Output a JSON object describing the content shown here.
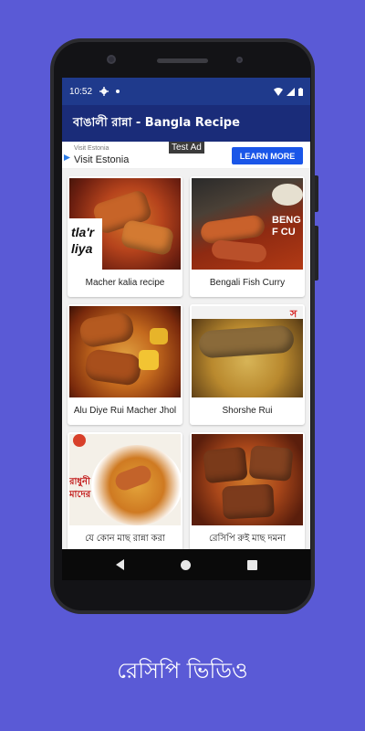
{
  "status_bar": {
    "time": "10:52"
  },
  "app_bar": {
    "title": "বাঙালী রান্না - Bangla Recipe"
  },
  "ad": {
    "badge": "Test Ad",
    "sponsor_small": "Visit Estonia",
    "sponsor_title": "Visit Estonia",
    "cta": "LEARN MORE"
  },
  "recipes": [
    {
      "title": "Macher kalia recipe",
      "overlay": "tla'r liya"
    },
    {
      "title": "Bengali Fish Curry",
      "overlay": "BENG F CU"
    },
    {
      "title": "Alu Diye Rui Macher Jhol",
      "overlay": ""
    },
    {
      "title": "Shorshe Rui",
      "overlay": "স"
    },
    {
      "title": "যে কোন মাছ রান্না করা",
      "overlay": "রাধুনী মাদের"
    },
    {
      "title": "রেসিপি রুই মাছ দমনা",
      "overlay": ""
    }
  ],
  "bottom_caption": "রেসিপি ভিডিও",
  "colors": {
    "background": "#5a5ad6",
    "status_bar": "#1f3a8c",
    "app_bar": "#1a2c79",
    "ad_button": "#1a56e8"
  }
}
